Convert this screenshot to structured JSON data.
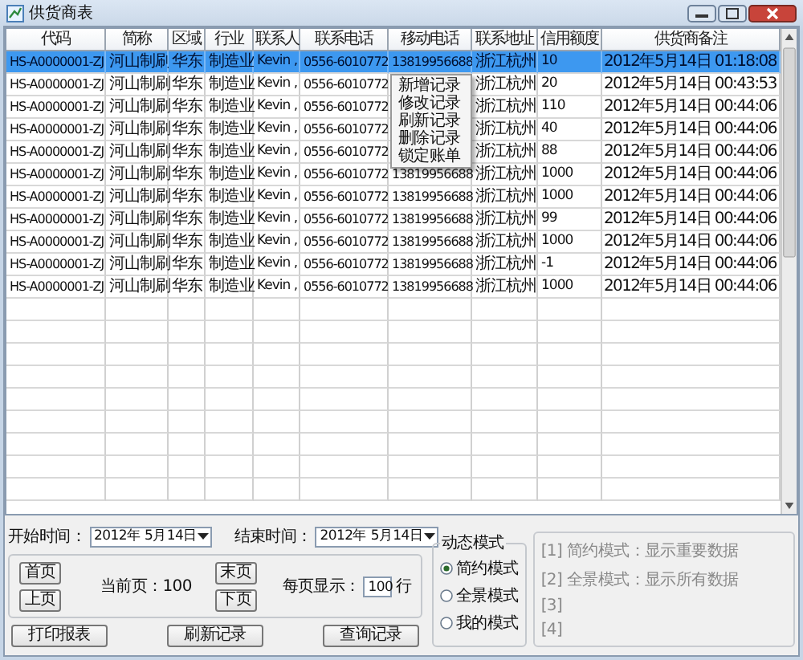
{
  "window": {
    "title": "供货商表"
  },
  "table": {
    "columns": [
      "代码",
      "简称",
      "区域",
      "行业",
      "联系人",
      "联系电话",
      "移动电话",
      "联系地址",
      "信用额度",
      "供货商备注"
    ],
    "rows": [
      {
        "selected": true,
        "cells": [
          "HS-A0000001-ZJ",
          "河山制刷",
          "华东",
          "制造业",
          "Kevin ,",
          "0556-6010772",
          "13819956688",
          "浙江杭州",
          "10",
          "2012年5月14日 01:18:08"
        ]
      },
      {
        "selected": false,
        "cells": [
          "HS-A0000001-ZJ",
          "河山制刷",
          "华东",
          "制造业",
          "Kevin ,",
          "0556-6010772",
          null,
          "浙江杭州",
          "20",
          "2012年5月14日 00:43:53"
        ]
      },
      {
        "selected": false,
        "cells": [
          "HS-A0000001-ZJ",
          "河山制刷",
          "华东",
          "制造业",
          "Kevin ,",
          "0556-6010772",
          null,
          "浙江杭州",
          "110",
          "2012年5月14日 00:44:06"
        ]
      },
      {
        "selected": false,
        "cells": [
          "HS-A0000001-ZJ",
          "河山制刷",
          "华东",
          "制造业",
          "Kevin ,",
          "0556-6010772",
          null,
          "浙江杭州",
          "40",
          "2012年5月14日 00:44:06"
        ]
      },
      {
        "selected": false,
        "cells": [
          "HS-A0000001-ZJ",
          "河山制刷",
          "华东",
          "制造业",
          "Kevin ,",
          "0556-6010772",
          null,
          "浙江杭州",
          "88",
          "2012年5月14日 00:44:06"
        ]
      },
      {
        "selected": false,
        "cells": [
          "HS-A0000001-ZJ",
          "河山制刷",
          "华东",
          "制造业",
          "Kevin ,",
          "0556-6010772",
          "13819956688",
          "浙江杭州",
          "1000",
          "2012年5月14日 00:44:06"
        ]
      },
      {
        "selected": false,
        "cells": [
          "HS-A0000001-ZJ",
          "河山制刷",
          "华东",
          "制造业",
          "Kevin ,",
          "0556-6010772",
          "13819956688",
          "浙江杭州",
          "1000",
          "2012年5月14日 00:44:06"
        ]
      },
      {
        "selected": false,
        "cells": [
          "HS-A0000001-ZJ",
          "河山制刷",
          "华东",
          "制造业",
          "Kevin ,",
          "0556-6010772",
          "13819956688",
          "浙江杭州",
          "99",
          "2012年5月14日 00:44:06"
        ]
      },
      {
        "selected": false,
        "cells": [
          "HS-A0000001-ZJ",
          "河山制刷",
          "华东",
          "制造业",
          "Kevin ,",
          "0556-6010772",
          "13819956688",
          "浙江杭州",
          "1000",
          "2012年5月14日 00:44:06"
        ]
      },
      {
        "selected": false,
        "cells": [
          "HS-A0000001-ZJ",
          "河山制刷",
          "华东",
          "制造业",
          "Kevin ,",
          "0556-6010772",
          "13819956688",
          "浙江杭州",
          "-1",
          "2012年5月14日 00:44:06"
        ]
      },
      {
        "selected": false,
        "cells": [
          "HS-A0000001-ZJ",
          "河山制刷",
          "华东",
          "制造业",
          "Kevin ,",
          "0556-6010772",
          "13819956688",
          "浙江杭州",
          "1000",
          "2012年5月14日 00:44:06"
        ]
      }
    ]
  },
  "context_menu": {
    "items": [
      "新增记录",
      "修改记录",
      "刷新记录",
      "删除记录",
      "锁定账单"
    ]
  },
  "filters": {
    "start_label": "开始时间：",
    "start_value": "2012年 5月14日",
    "end_label": "结束时间：",
    "end_value": "2012年 5月14日"
  },
  "pager": {
    "first": "首页",
    "prev": "上页",
    "current": "当前页：100",
    "last": "末页",
    "next": "下页",
    "per_page_label": "每页显示：",
    "per_page_value": "100",
    "per_page_unit": "行"
  },
  "actions": [
    "打印报表",
    "刷新记录",
    "查询记录"
  ],
  "mode": {
    "title": "动态模式",
    "options": [
      {
        "label": "简约模式",
        "selected": true
      },
      {
        "label": "全景模式",
        "selected": false
      },
      {
        "label": "我的模式",
        "selected": false
      }
    ]
  },
  "notes": [
    "[1] 简约模式：显示重要数据",
    "[2] 全景模式：显示所有数据",
    "[3]",
    "[4]"
  ]
}
